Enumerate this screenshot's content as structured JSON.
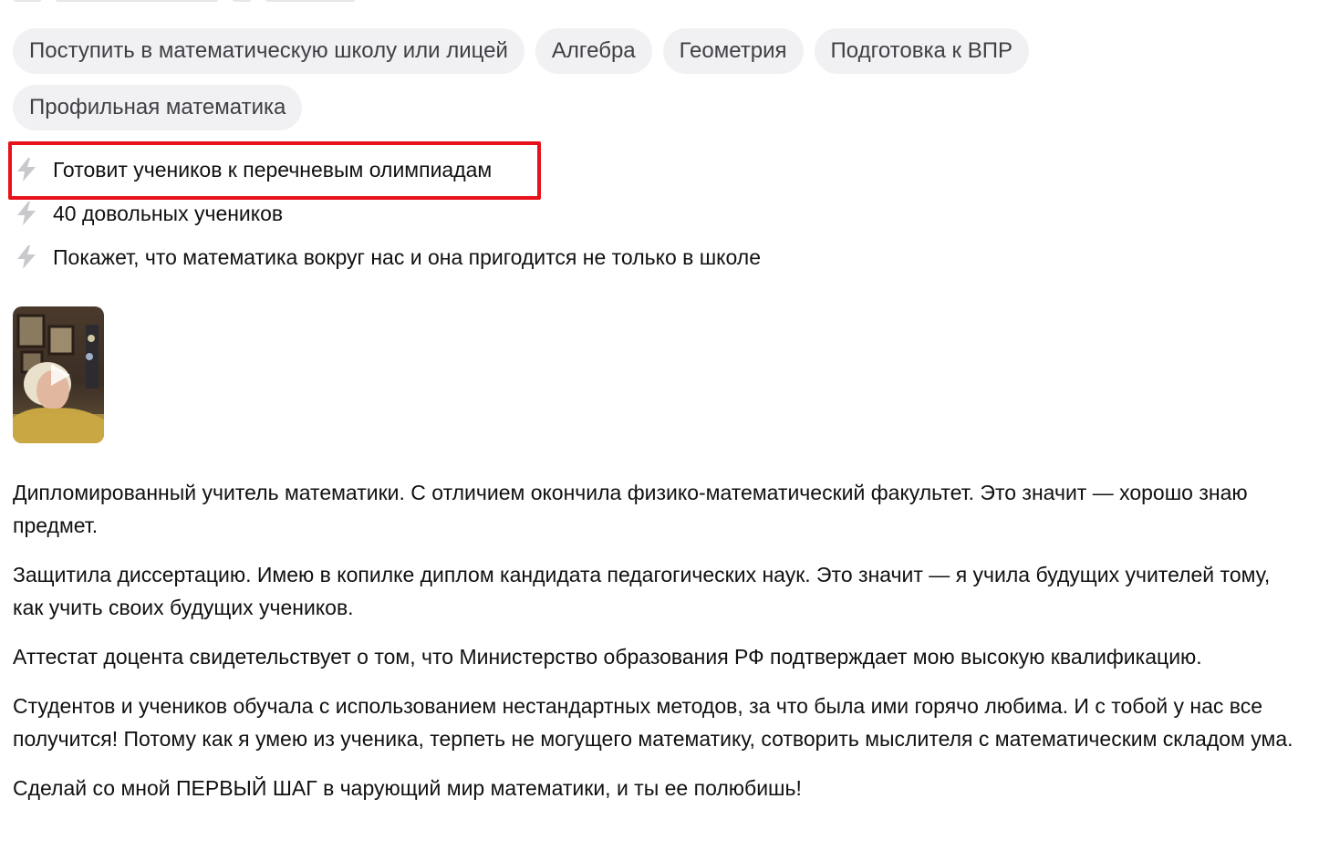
{
  "subjects": [
    {
      "label": "Поступить в математическую школу или лицей"
    },
    {
      "label": "Алгебра"
    },
    {
      "label": "Геометрия"
    },
    {
      "label": "Подготовка к ВПР"
    },
    {
      "label": "Профильная математика"
    }
  ],
  "features": [
    {
      "icon": "lightning-icon",
      "text": "Готовит учеников к перечневым олимпиадам",
      "highlighted": true
    },
    {
      "icon": "lightning-icon",
      "text": "40 довольных учеников",
      "highlighted": false
    },
    {
      "icon": "lightning-icon",
      "text": "Покажет, что математика вокруг нас и она пригодится не только в школе",
      "highlighted": false
    }
  ],
  "video": {
    "icon": "play-icon"
  },
  "about": [
    "Дипломированный учитель математики. С отличием окончила физико-математический факультет. Это значит — хорошо знаю предмет.",
    "Защитила диссертацию. Имею в копилке диплом кандидата педагогических наук. Это значит — я учила будущих учителей тому, как учить своих будущих учеников.",
    "Аттестат доцента свидетельствует о том, что Министерство образования РФ подтверждает мою высокую квалификацию.",
    "Студентов и учеников обучала с использованием нестандартных методов, за что была ими горячо любима. И с тобой у нас все получится! Потому как я умею из ученика, терпеть не могущего математику, сотворить мыслителя с математическим складом ума.",
    "Сделай со мной ПЕРВЫЙ ШАГ в чарующий мир математики, и ты ее полюбишь!"
  ],
  "colors": {
    "chip_bg": "#f1f1f3",
    "highlight": "#e8111a",
    "icon_gray": "#c9c9cd"
  }
}
